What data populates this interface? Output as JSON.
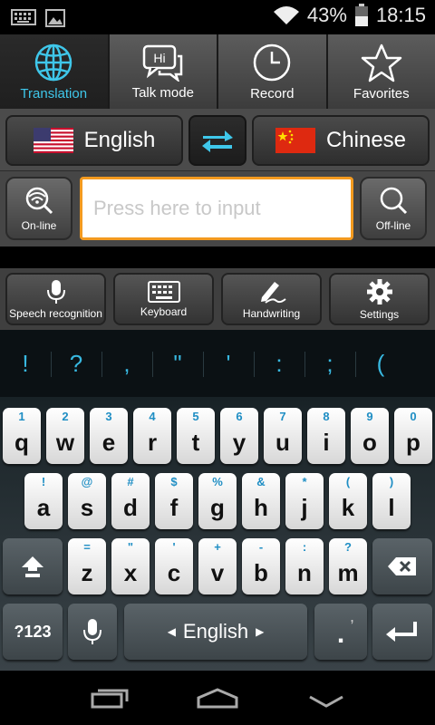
{
  "status_bar": {
    "battery": "43%",
    "time": "18:15"
  },
  "tabs": [
    {
      "label": "Translation",
      "active": true
    },
    {
      "label": "Talk mode",
      "icon_text": "Hi"
    },
    {
      "label": "Record"
    },
    {
      "label": "Favorites"
    }
  ],
  "languages": {
    "source": "English",
    "target": "Chinese"
  },
  "input": {
    "placeholder": "Press here to input",
    "online_label": "On-line",
    "offline_label": "Off-line"
  },
  "tools": [
    {
      "label": "Speech recognition"
    },
    {
      "label": "Keyboard"
    },
    {
      "label": "Handwriting"
    },
    {
      "label": "Settings"
    }
  ],
  "suggestions": [
    "!",
    "?",
    ",",
    "\"",
    "'",
    ":",
    ";",
    "("
  ],
  "keyboard": {
    "row1": [
      {
        "k": "q",
        "h": "1"
      },
      {
        "k": "w",
        "h": "2"
      },
      {
        "k": "e",
        "h": "3"
      },
      {
        "k": "r",
        "h": "4"
      },
      {
        "k": "t",
        "h": "5"
      },
      {
        "k": "y",
        "h": "6"
      },
      {
        "k": "u",
        "h": "7"
      },
      {
        "k": "i",
        "h": "8"
      },
      {
        "k": "o",
        "h": "9"
      },
      {
        "k": "p",
        "h": "0"
      }
    ],
    "row2": [
      {
        "k": "a",
        "h": "!"
      },
      {
        "k": "s",
        "h": "@"
      },
      {
        "k": "d",
        "h": "#"
      },
      {
        "k": "f",
        "h": "$"
      },
      {
        "k": "g",
        "h": "%"
      },
      {
        "k": "h",
        "h": "&"
      },
      {
        "k": "j",
        "h": "*"
      },
      {
        "k": "k",
        "h": "("
      },
      {
        "k": "l",
        "h": ")"
      }
    ],
    "row3": [
      {
        "k": "z",
        "h": "="
      },
      {
        "k": "x",
        "h": "\""
      },
      {
        "k": "c",
        "h": "'"
      },
      {
        "k": "v",
        "h": "+"
      },
      {
        "k": "b",
        "h": "-"
      },
      {
        "k": "n",
        "h": ":"
      },
      {
        "k": "m",
        "h": "?"
      }
    ],
    "sym_label": "?123",
    "space_label": "English",
    "period_key": ".",
    "period_hint": ","
  },
  "colors": {
    "accent": "#3fc7ea",
    "input_border": "#f39a1f",
    "key_hint": "#1f8ec4"
  }
}
